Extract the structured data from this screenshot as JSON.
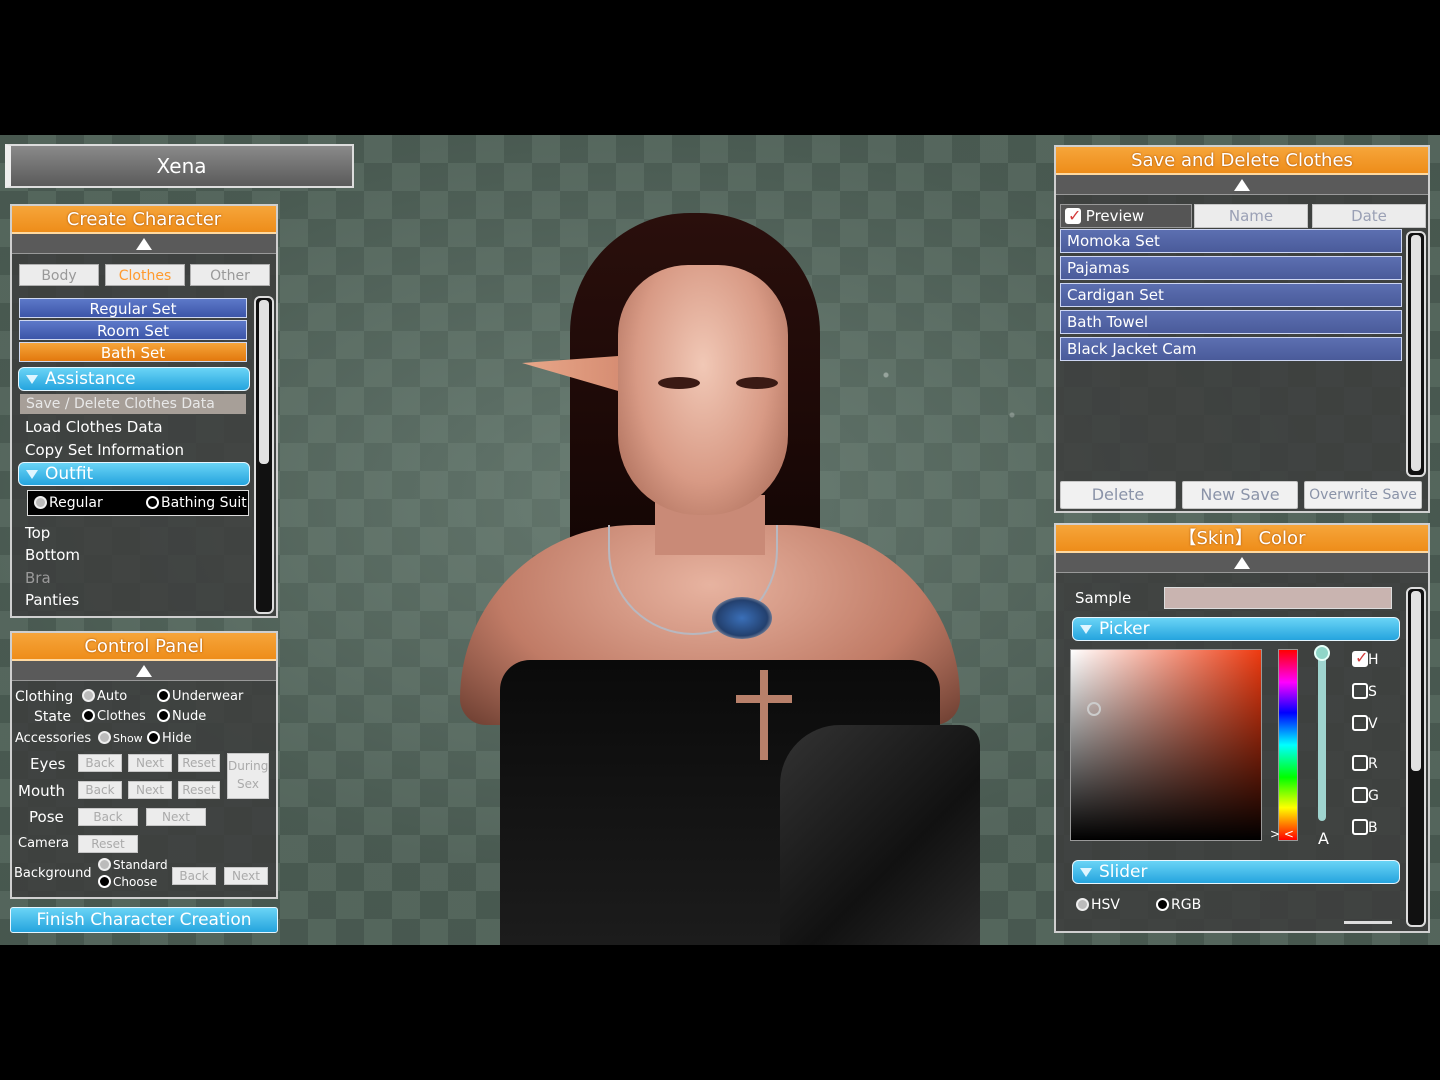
{
  "header": {
    "character_name": "Xena"
  },
  "create_panel": {
    "title": "Create Character",
    "tabs": [
      "Body",
      "Clothes",
      "Other"
    ],
    "sets": [
      {
        "label": "Regular Set",
        "state": "normal"
      },
      {
        "label": "Room Set",
        "state": "normal"
      },
      {
        "label": "Bath Set",
        "state": "selected"
      }
    ],
    "assistance_header": "Assistance",
    "assistance_items": [
      "Save / Delete Clothes Data",
      "Load Clothes Data",
      "Copy Set Information"
    ],
    "outfit_header": "Outfit",
    "outfit_options": {
      "regular": "Regular",
      "bathing": "Bathing Suit",
      "selected": "regular"
    },
    "outfit_items": [
      "Top",
      "Bottom",
      "Bra",
      "Panties"
    ]
  },
  "control_panel": {
    "title": "Control Panel",
    "clothing_state_label_1": "Clothing",
    "clothing_state_label_2": "State",
    "clothing_opts": [
      "Auto",
      "Underwear",
      "Clothes",
      "Nude"
    ],
    "accessories_label": "Accessories",
    "accessories_opts": [
      "Show",
      "Hide"
    ],
    "eyes_label": "Eyes",
    "mouth_label": "Mouth",
    "pose_label": "Pose",
    "camera_label": "Camera",
    "background_label": "Background",
    "background_opts": [
      "Standard",
      "Choose"
    ],
    "btn_back": "Back",
    "btn_next": "Next",
    "btn_reset": "Reset",
    "during_sex_1": "During",
    "during_sex_2": "Sex"
  },
  "finish_button": "Finish Character Creation",
  "save_panel": {
    "title": "Save and Delete Clothes",
    "preview_label": "Preview",
    "col_name": "Name",
    "col_date": "Date",
    "items": [
      "Momoka Set",
      "Pajamas",
      "Cardigan Set",
      "Bath Towel",
      "Black Jacket Cam"
    ],
    "delete": "Delete",
    "new_save": "New Save",
    "overwrite": "Overwrite Save"
  },
  "color_panel": {
    "title": "【Skin】 Color",
    "sample_label": "Sample",
    "picker_header": "Picker",
    "slider_header": "Slider",
    "channels": [
      "H",
      "S",
      "V",
      "R",
      "G",
      "B"
    ],
    "alpha_label": "A",
    "mode_hsv": "HSV",
    "mode_rgb": "RGB",
    "sample_color": "#c9b4b0",
    "hue_color": "#ee3a10"
  }
}
